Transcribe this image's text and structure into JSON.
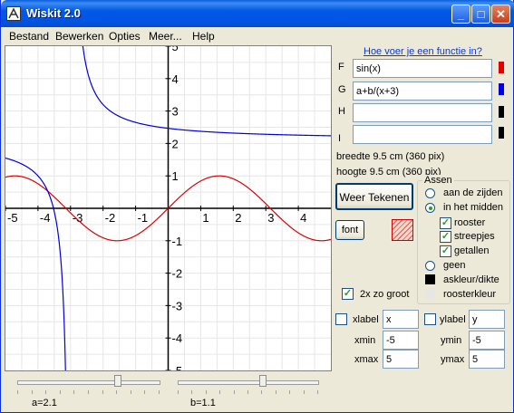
{
  "window": {
    "title": "Wiskit 2.0"
  },
  "titlebar_buttons": {
    "minimize": "_",
    "maximize": "□",
    "close": "✕"
  },
  "menu": [
    "Bestand",
    "Bewerken",
    "Opties",
    "Meer...",
    "Help"
  ],
  "help_link": "Hoe voer je een functie in?",
  "functions": [
    {
      "label": "F",
      "value": "sin(x)",
      "color": "#e00000"
    },
    {
      "label": "G",
      "value": "a+b/(x+3)",
      "color": "#0000e0"
    },
    {
      "label": "H",
      "value": "",
      "color": "#000000"
    },
    {
      "label": "I",
      "value": "",
      "color": "#000000"
    }
  ],
  "size_info": {
    "width": "breedte 9.5 cm (360 pix)",
    "height": "hoogte  9.5 cm (360 pix)"
  },
  "buttons": {
    "redraw": "Weer Tekenen",
    "font": "font"
  },
  "axes_group": {
    "title": "Assen",
    "edges": "aan de zijden",
    "middle": "in het midden",
    "grid": "rooster",
    "ticks": "streepjes",
    "numbers": "getallen",
    "none": "geen",
    "axis_color": "askleur/dikte",
    "grid_color": "roosterkleur"
  },
  "double_size": "2x zo groot",
  "axis_settings": {
    "xlabel": "xlabel",
    "xlabel_value": "x",
    "ylabel": "ylabel",
    "ylabel_value": "y",
    "xmin": "xmin",
    "xmin_value": "-5",
    "xmax": "xmax",
    "xmax_value": "5",
    "ymin": "ymin",
    "ymin_value": "-5",
    "ymax": "ymax",
    "ymax_value": "5"
  },
  "sliders": [
    {
      "label": "a=2.1",
      "value": 2.1,
      "min": -5,
      "max": 5
    },
    {
      "label": "b=1.1",
      "value": 1.1,
      "min": -5,
      "max": 5
    }
  ],
  "chart_data": {
    "type": "line",
    "xlim": [
      -5,
      5
    ],
    "ylim": [
      -5,
      5
    ],
    "grid": true,
    "x_ticks": [
      -5,
      -4,
      -3,
      -2,
      -1,
      1,
      2,
      3,
      4
    ],
    "y_ticks": [
      5,
      4,
      3,
      2,
      1,
      -1,
      -2,
      -3,
      -4,
      -5
    ],
    "series": [
      {
        "name": "F",
        "expression": "sin(x)",
        "color": "#e00000"
      },
      {
        "name": "G",
        "expression": "a+b/(x+3)",
        "color": "#0000e0",
        "a": 2.1,
        "b": 1.1
      }
    ]
  }
}
